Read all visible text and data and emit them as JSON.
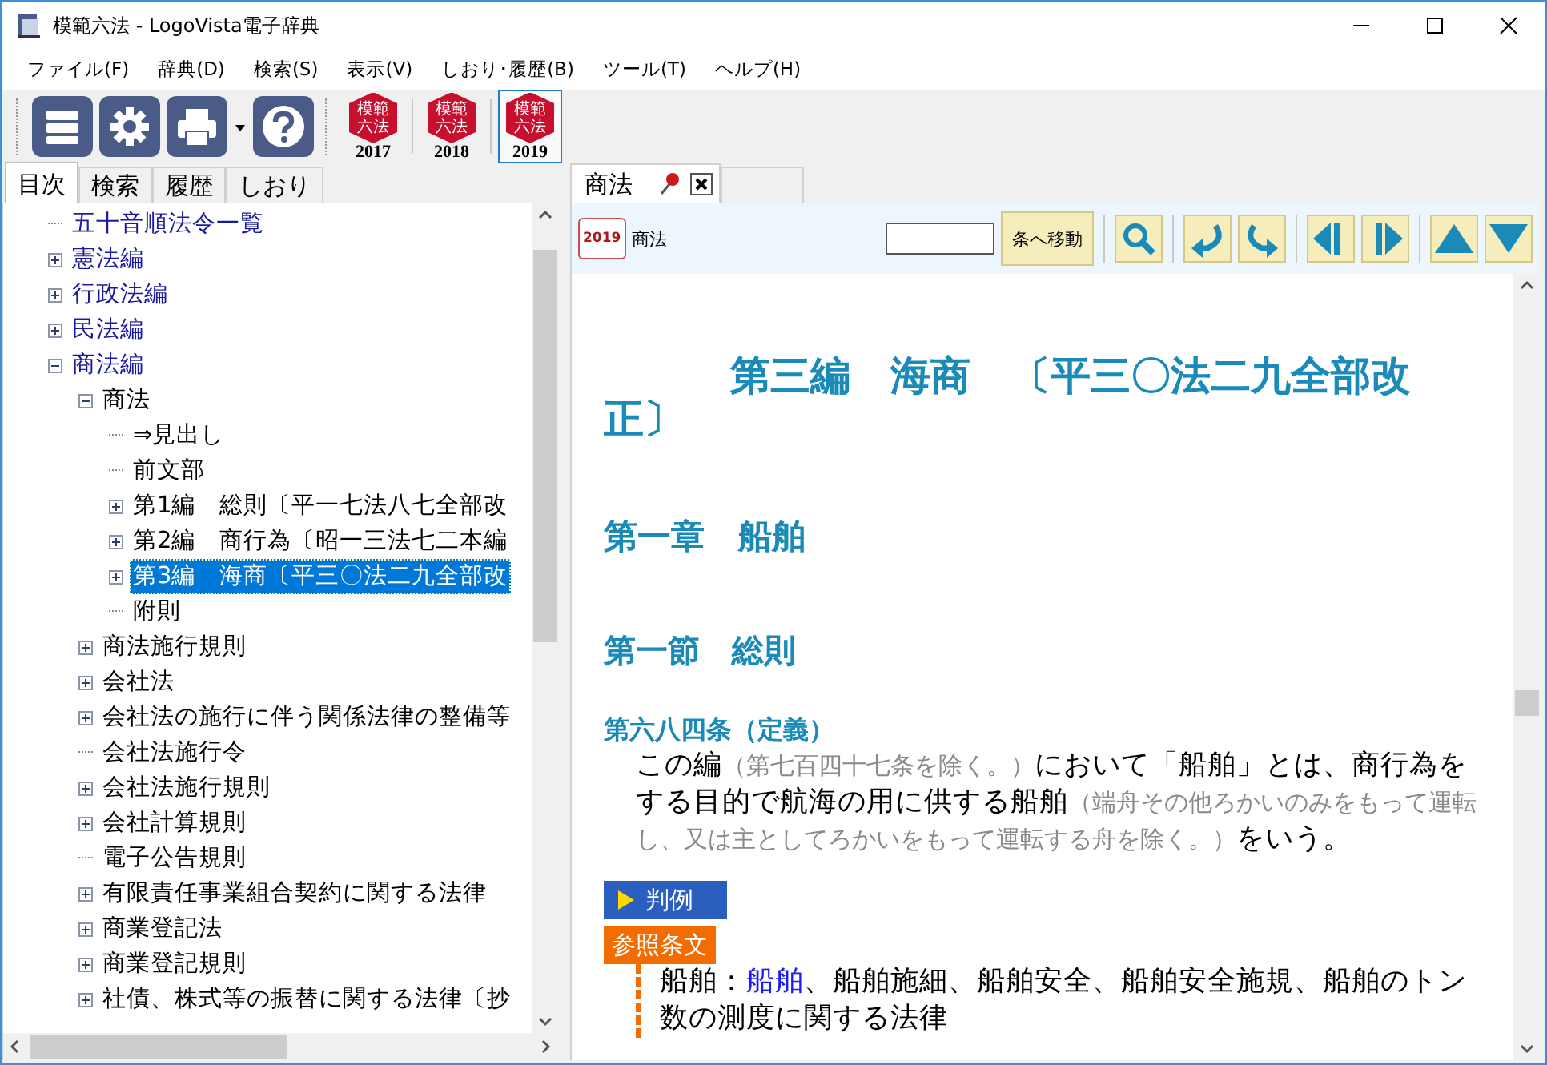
{
  "window": {
    "title": "模範六法 - LogoVista電子辞典"
  },
  "menu": [
    {
      "label": "ファイル(F)"
    },
    {
      "label": "辞典(D)"
    },
    {
      "label": "検索(S)"
    },
    {
      "label": "表示(V)"
    },
    {
      "label": "しおり･履歴(B)"
    },
    {
      "label": "ツール(T)"
    },
    {
      "label": "ヘルプ(H)"
    }
  ],
  "editions": [
    {
      "mark_top": "模範",
      "mark_bottom": "六法",
      "year": "2017",
      "selected": false
    },
    {
      "mark_top": "模範",
      "mark_bottom": "六法",
      "year": "2018",
      "selected": false
    },
    {
      "mark_top": "模範",
      "mark_bottom": "六法",
      "year": "2019",
      "selected": true
    }
  ],
  "side_tabs": [
    {
      "label": "目次",
      "selected": true
    },
    {
      "label": "検索",
      "selected": false
    },
    {
      "label": "履歴",
      "selected": false
    },
    {
      "label": "しおり",
      "selected": false
    }
  ],
  "tree": [
    {
      "label": "五十音順法令一覧",
      "kind": "leaf",
      "selected": false
    },
    {
      "label": "憲法編",
      "kind": "folder",
      "expanded": false,
      "selected": false
    },
    {
      "label": "行政法編",
      "kind": "folder",
      "expanded": false,
      "selected": false
    },
    {
      "label": "民法編",
      "kind": "folder",
      "expanded": false,
      "selected": false
    },
    {
      "label": "商法編",
      "kind": "folder",
      "expanded": true,
      "selected": false,
      "children": [
        {
          "label": "商法",
          "kind": "folder",
          "expanded": true,
          "selected": false,
          "children": [
            {
              "label": "⇒見出し",
              "kind": "leaf",
              "selected": false
            },
            {
              "label": "前文部",
              "kind": "leaf",
              "selected": false
            },
            {
              "label": "第1編　総則〔平一七法八七全部改",
              "kind": "folder",
              "expanded": false,
              "selected": false
            },
            {
              "label": "第2編　商行為〔昭一三法七二本編",
              "kind": "folder",
              "expanded": false,
              "selected": false
            },
            {
              "label": "第3編　海商〔平三〇法二九全部改",
              "kind": "folder",
              "expanded": false,
              "selected": true
            },
            {
              "label": "附則",
              "kind": "leaf",
              "selected": false
            }
          ]
        },
        {
          "label": "商法施行規則",
          "kind": "folder",
          "expanded": false,
          "selected": false
        },
        {
          "label": "会社法",
          "kind": "folder",
          "expanded": false,
          "selected": false
        },
        {
          "label": "会社法の施行に伴う関係法律の整備等",
          "kind": "folder",
          "expanded": false,
          "selected": false
        },
        {
          "label": "会社法施行令",
          "kind": "leaf",
          "selected": false
        },
        {
          "label": "会社法施行規則",
          "kind": "folder",
          "expanded": false,
          "selected": false
        },
        {
          "label": "会社計算規則",
          "kind": "folder",
          "expanded": false,
          "selected": false
        },
        {
          "label": "電子公告規則",
          "kind": "leaf",
          "selected": false
        },
        {
          "label": "有限責任事業組合契約に関する法律",
          "kind": "folder",
          "expanded": false,
          "selected": false
        },
        {
          "label": "商業登記法",
          "kind": "folder",
          "expanded": false,
          "selected": false
        },
        {
          "label": "商業登記規則",
          "kind": "folder",
          "expanded": false,
          "selected": false
        },
        {
          "label": "社債、株式等の振替に関する法律〔抄",
          "kind": "folder",
          "expanded": false,
          "selected": false
        }
      ]
    }
  ],
  "doc_tab": {
    "label": "商法",
    "selected": true
  },
  "doc_toolbar": {
    "badge": "2019",
    "title": "商法",
    "jump_button": "条へ移動"
  },
  "content": [
    {
      "kind": "part",
      "text": "第三編　海商　〔平三〇法二九全部改正〕"
    },
    {
      "kind": "chapter",
      "text": "第一章　船舶"
    },
    {
      "kind": "section",
      "text": "第一節　総則"
    },
    {
      "kind": "article",
      "text": "第六八四条（定義）"
    },
    {
      "kind": "paragraph",
      "segments": [
        {
          "kind": "text",
          "text": "この編"
        },
        {
          "kind": "note",
          "text": "（第七百四十七条を除く。）"
        },
        {
          "kind": "text",
          "text": "において「船舶」とは、商行為をする目的で航海の用に供する船舶"
        },
        {
          "kind": "note",
          "text": "（端舟その他ろかいのみをもって運転し、又は主としてろかいをもって運転する舟を除く。）"
        },
        {
          "kind": "text",
          "text": "をいう。"
        }
      ]
    },
    {
      "kind": "case_tag",
      "text": "判例"
    },
    {
      "kind": "ref_tag",
      "text": "参照条文"
    },
    {
      "kind": "refs",
      "segments": [
        {
          "kind": "text",
          "text": "船舶："
        },
        {
          "kind": "link",
          "text": "船舶"
        },
        {
          "kind": "text",
          "text": "、船舶施細、船舶安全、船舶安全施規、船舶のトン数の測度に関する法律"
        }
      ]
    }
  ]
}
